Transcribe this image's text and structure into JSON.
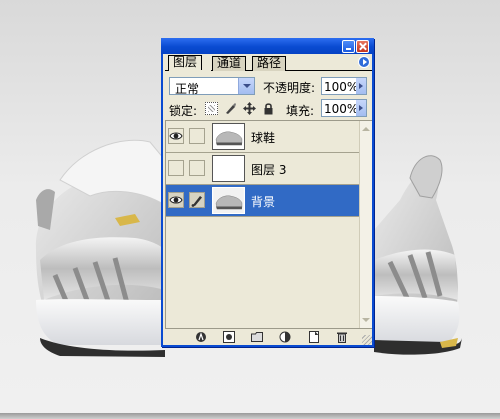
{
  "panel": {
    "tabs": [
      "图层",
      "通道",
      "路径"
    ],
    "blend_mode": "正常",
    "opacity_label": "不透明度:",
    "opacity_value": "100%",
    "lock_label": "锁定:",
    "fill_label": "填充:",
    "fill_value": "100%",
    "layers": [
      {
        "name": "球鞋",
        "visible": true,
        "selected": false
      },
      {
        "name": "图层 3",
        "visible": false,
        "selected": false
      },
      {
        "name": "背景",
        "visible": true,
        "selected": true
      }
    ]
  },
  "colors": {
    "selection": "#316ac5",
    "panel_bg": "#ece9d8",
    "titlebar": "#0a4bd1"
  },
  "icons": {
    "toolbar": [
      "link-layers-icon",
      "layer-style-icon",
      "layer-mask-icon",
      "new-group-icon",
      "adjustment-layer-icon",
      "new-layer-icon",
      "delete-layer-icon"
    ],
    "lock": [
      "lock-transparency-icon",
      "lock-image-icon",
      "lock-position-icon",
      "lock-all-icon"
    ]
  }
}
